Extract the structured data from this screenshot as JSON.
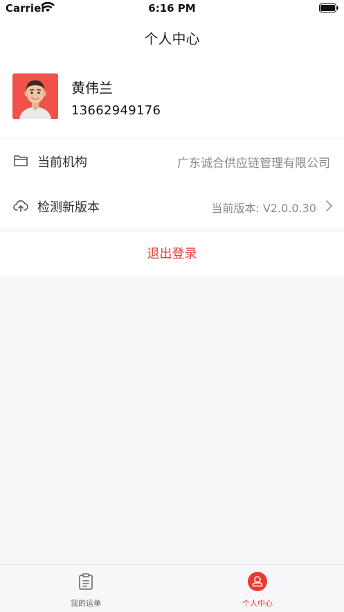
{
  "status_bar": {
    "carrier": "Carrier",
    "time": "6:16 PM"
  },
  "nav": {
    "title": "个人中心"
  },
  "profile": {
    "name": "黄伟兰",
    "phone": "13662949176"
  },
  "info": {
    "org_label": "当前机构",
    "org_value": "广东诚合供应链管理有限公司",
    "version_label": "检测新版本",
    "version_value": "当前版本: V2.0.0.30"
  },
  "logout": {
    "label": "退出登录"
  },
  "tabs": [
    {
      "label": "我的运单",
      "icon": "clipboard-icon",
      "active": false
    },
    {
      "label": "个人中心",
      "icon": "user-icon",
      "active": true
    }
  ],
  "colors": {
    "accent": "#e83a31",
    "inactive": "#666666",
    "background": "#f7f8fa"
  }
}
